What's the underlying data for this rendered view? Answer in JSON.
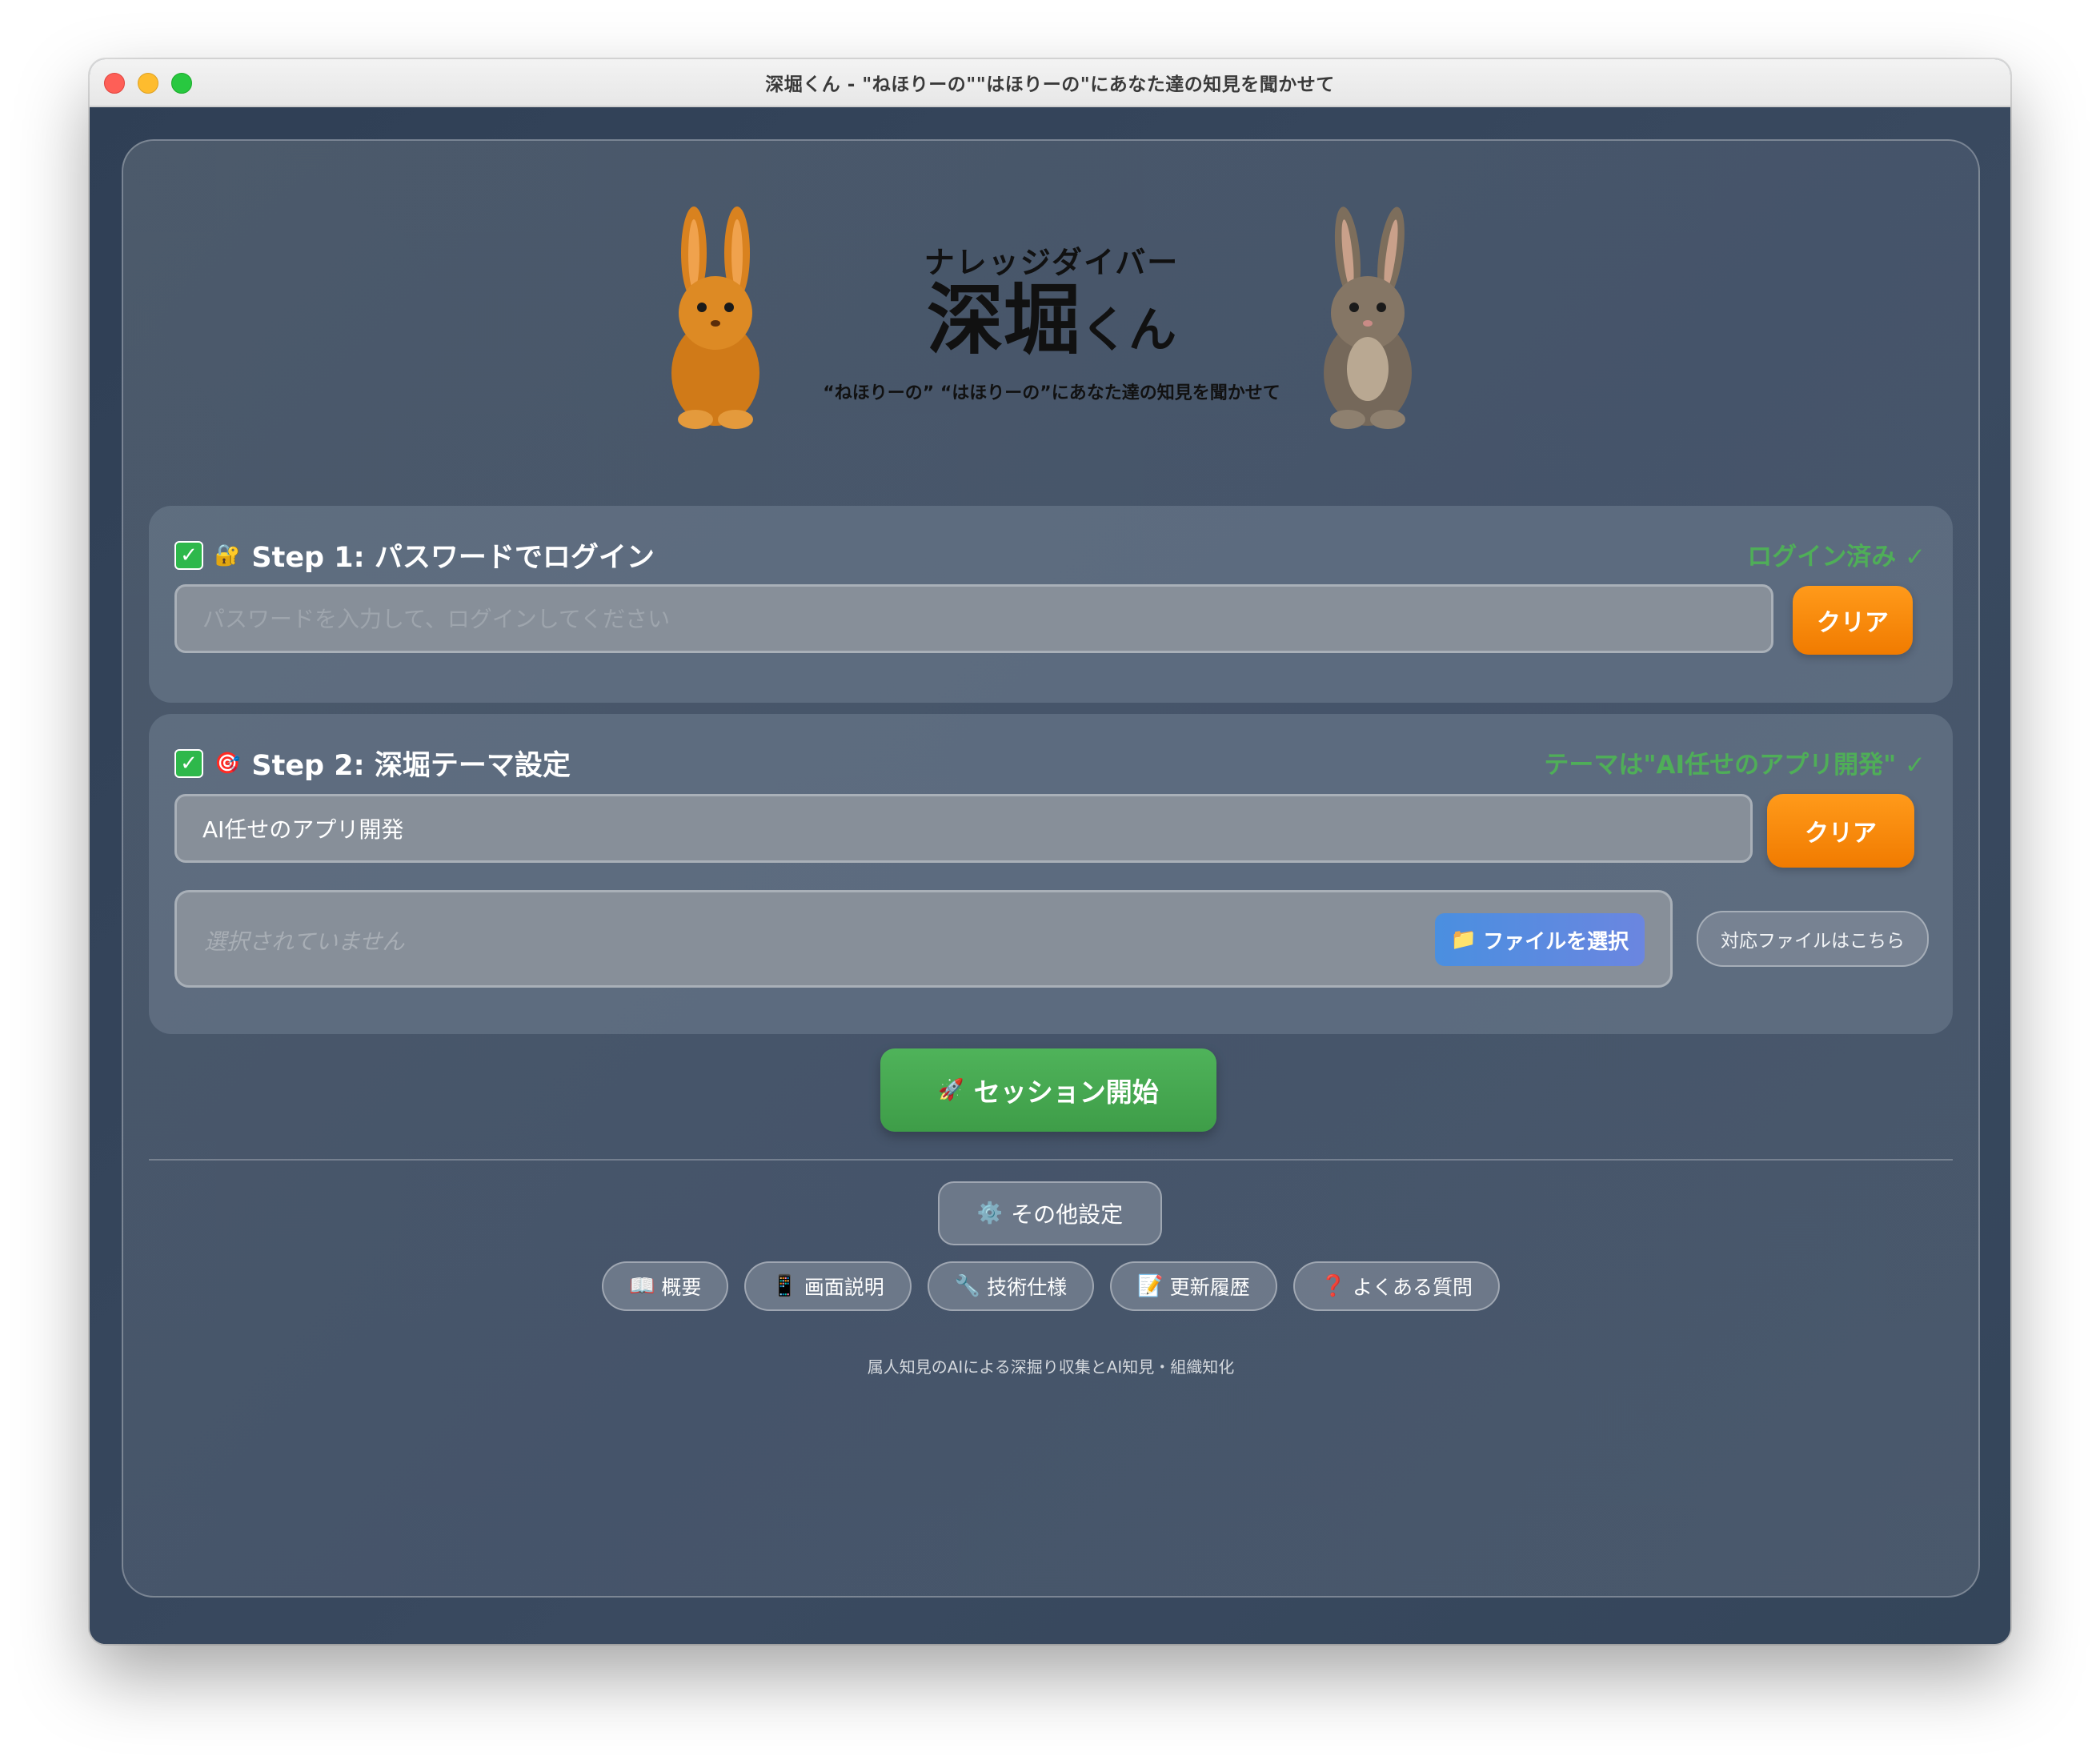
{
  "window": {
    "title": "深堀くん - \"ねほりーの\"\"はほりーの\"にあなた達の知見を聞かせて"
  },
  "header": {
    "logo_kana": "ナレッジダイバー",
    "logo_main": "深堀",
    "logo_main_suffix": "くん",
    "logo_tagline": "“ねほりーの” “はほりーの”にあなた達の知見を聞かせて"
  },
  "step1": {
    "title": "Step 1: パスワードでログイン",
    "status": "ログイン済み ✓",
    "password_placeholder": "パスワードを入力して、ログインしてください",
    "password_value": "",
    "clear_label": "クリア"
  },
  "step2": {
    "title": "Step 2: 深堀テーマ設定",
    "status": "テーマは\"AI任せのアプリ開発\" ✓",
    "theme_value": "AI任せのアプリ開発",
    "clear_label": "クリア",
    "file_status": "選択されていません",
    "file_button_label": "ファイルを選択",
    "supported_files_label": "対応ファイルはこちら"
  },
  "actions": {
    "start_label": "セッション開始",
    "settings_label": "その他設定"
  },
  "info_links": [
    {
      "label": "概要",
      "icon": "book-icon"
    },
    {
      "label": "画面説明",
      "icon": "phone-icon"
    },
    {
      "label": "技術仕様",
      "icon": "wrench-icon"
    },
    {
      "label": "更新履歴",
      "icon": "memo-icon"
    },
    {
      "label": "よくある質問",
      "icon": "question-icon"
    }
  ],
  "footer": {
    "note": "属人知見のAIによる深掘り収集とAI知見・組織知化"
  },
  "colors": {
    "accent_orange": "#f58a0b",
    "status_green": "#4fae58",
    "start_green": "#46a851",
    "file_button_blue": "#5a8ae0"
  }
}
